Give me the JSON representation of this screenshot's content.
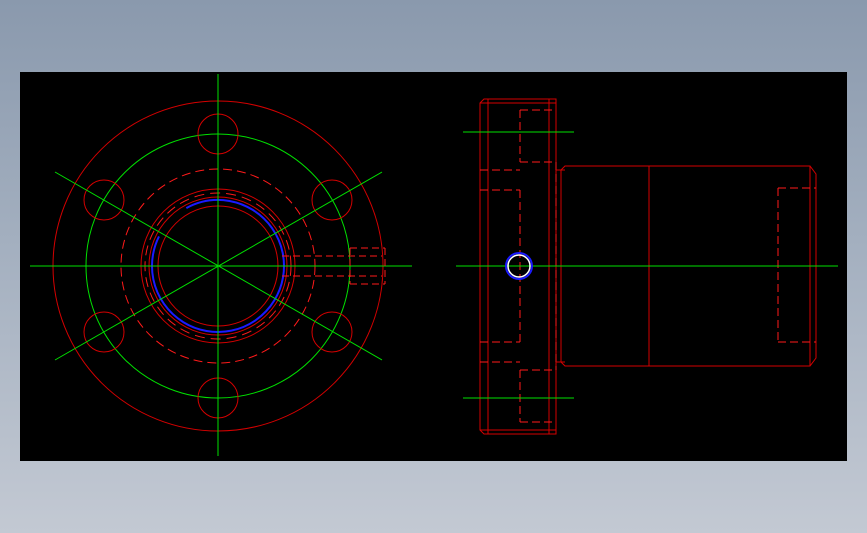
{
  "viewport": {
    "background": "#000000"
  },
  "colors": {
    "outline": "#d40000",
    "hidden": "#ff1a1a",
    "centerline": "#00e000",
    "inner_ring": "#1a1aff",
    "marker": "#ffffff"
  },
  "views": [
    {
      "name": "front-view",
      "description_visible": false
    },
    {
      "name": "side-view",
      "description_visible": false
    }
  ]
}
